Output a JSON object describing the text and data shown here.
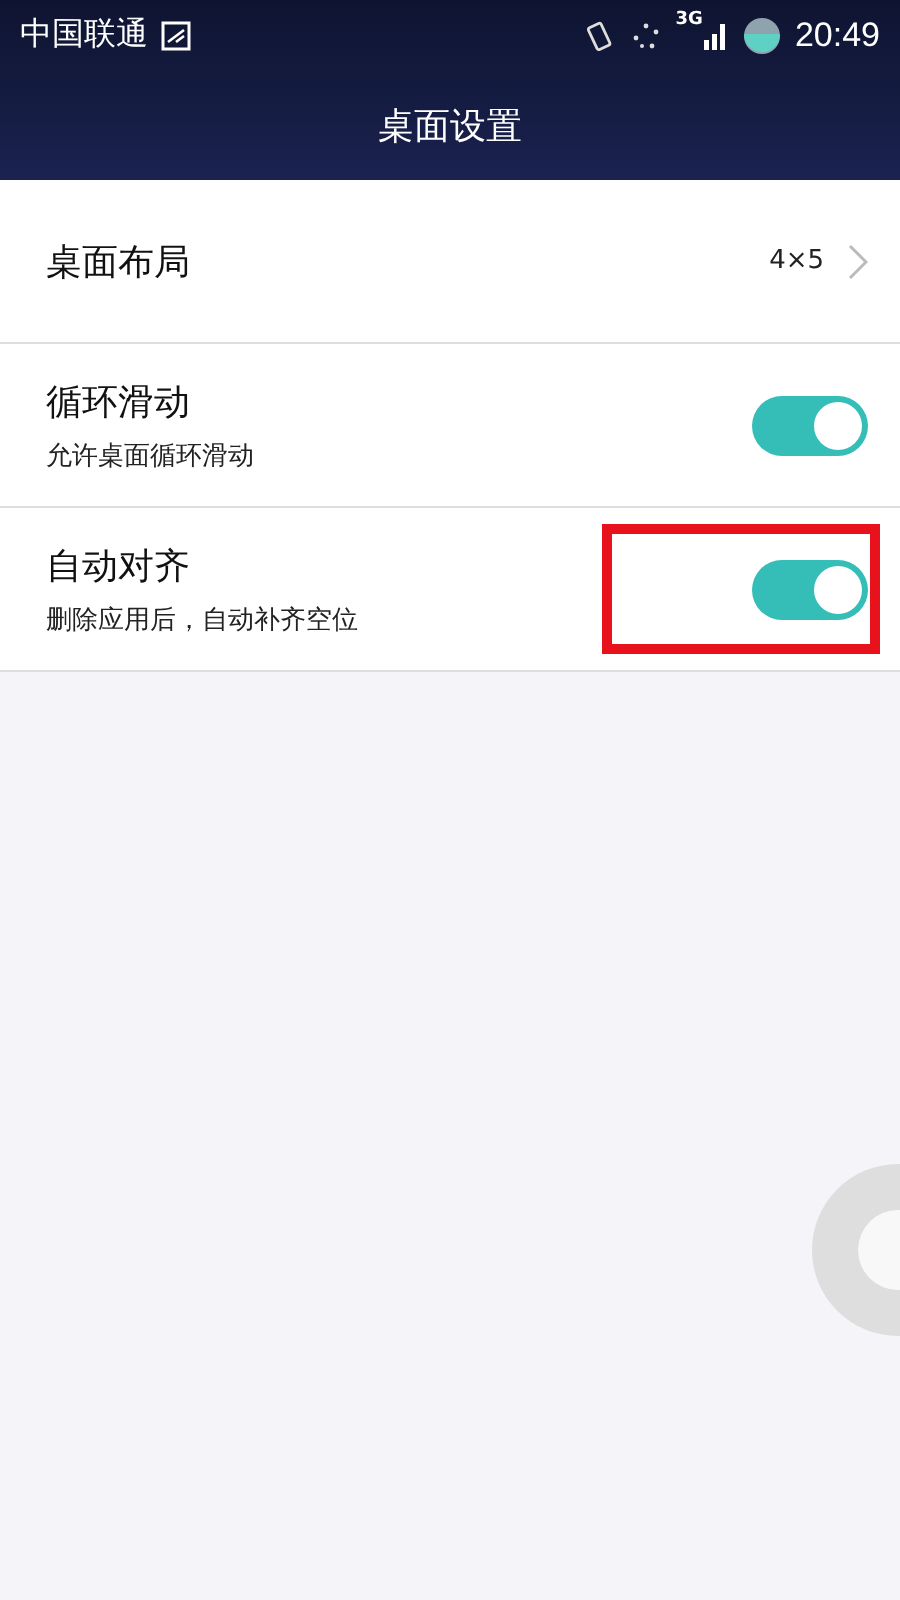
{
  "status_bar": {
    "carrier": "中国联通",
    "network": "3G",
    "time": "20:49"
  },
  "header": {
    "title": "桌面设置"
  },
  "items": [
    {
      "kind": "link",
      "title": "桌面布局",
      "value": "4×5",
      "highlighted": false
    },
    {
      "kind": "toggle",
      "title": "循环滑动",
      "subtitle": "允许桌面循环滑动",
      "on": true,
      "highlighted": false
    },
    {
      "kind": "toggle",
      "title": "自动对齐",
      "subtitle": "删除应用后，自动补齐空位",
      "on": true,
      "highlighted": true
    }
  ]
}
